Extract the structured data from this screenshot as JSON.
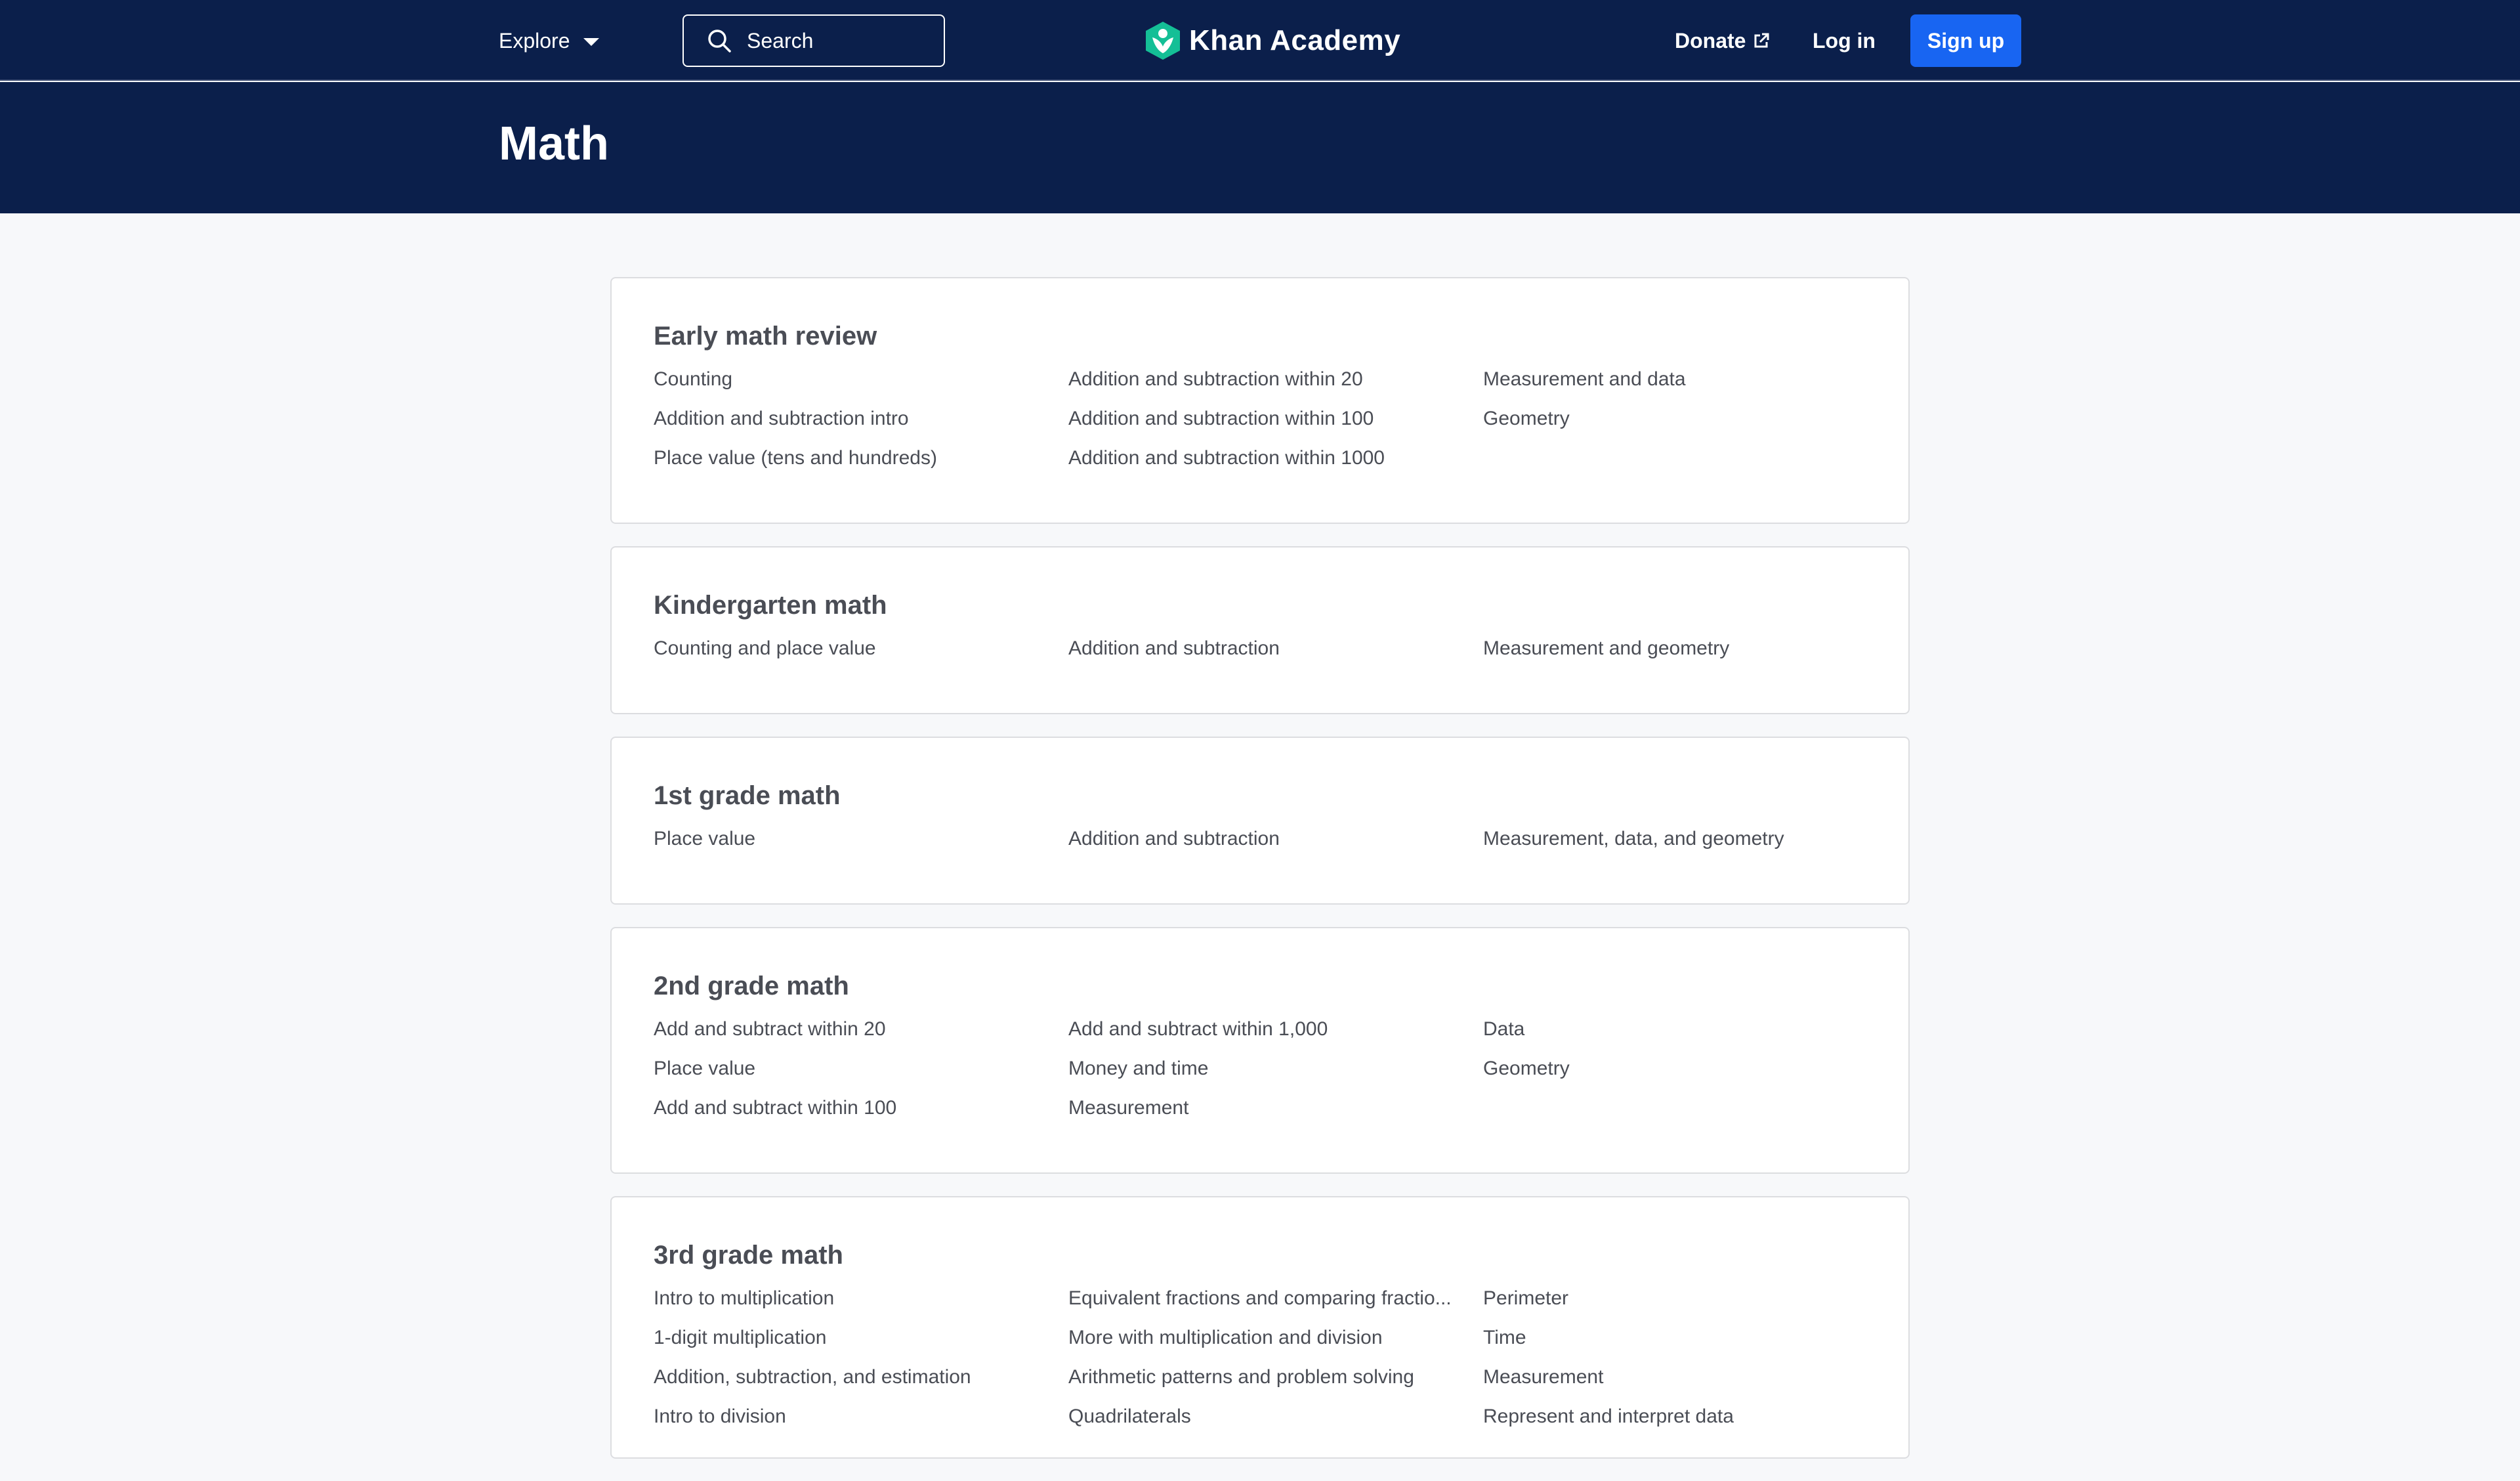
{
  "nav": {
    "explore": "Explore",
    "search_placeholder": "Search",
    "brand": "Khan Academy",
    "donate": "Donate",
    "login": "Log in",
    "signup": "Sign up"
  },
  "page": {
    "title": "Math"
  },
  "colors": {
    "navy": "#0b1f4b",
    "accent": "#1865f2",
    "logo_green": "#14bf96"
  },
  "courses": [
    {
      "title": "Early math review",
      "columns": [
        [
          "Counting",
          "Addition and subtraction intro",
          "Place value (tens and hundreds)"
        ],
        [
          "Addition and subtraction within 20",
          "Addition and subtraction within 100",
          "Addition and subtraction within 1000"
        ],
        [
          "Measurement and data",
          "Geometry"
        ]
      ]
    },
    {
      "title": "Kindergarten math",
      "columns": [
        [
          "Counting and place value"
        ],
        [
          "Addition and subtraction"
        ],
        [
          "Measurement and geometry"
        ]
      ]
    },
    {
      "title": "1st grade math",
      "columns": [
        [
          "Place value"
        ],
        [
          "Addition and subtraction"
        ],
        [
          "Measurement, data, and geometry"
        ]
      ]
    },
    {
      "title": "2nd grade math",
      "columns": [
        [
          "Add and subtract within 20",
          "Place value",
          "Add and subtract within 100"
        ],
        [
          "Add and subtract within 1,000",
          "Money and time",
          "Measurement"
        ],
        [
          "Data",
          "Geometry"
        ]
      ]
    },
    {
      "title": "3rd grade math",
      "columns": [
        [
          "Intro to multiplication",
          "1-digit multiplication",
          "Addition, subtraction, and estimation",
          "Intro to division"
        ],
        [
          "Equivalent fractions and comparing fractio...",
          "More with multiplication and division",
          "Arithmetic patterns and problem solving",
          "Quadrilaterals"
        ],
        [
          "Perimeter",
          "Time",
          "Measurement",
          "Represent and interpret data"
        ]
      ]
    }
  ]
}
